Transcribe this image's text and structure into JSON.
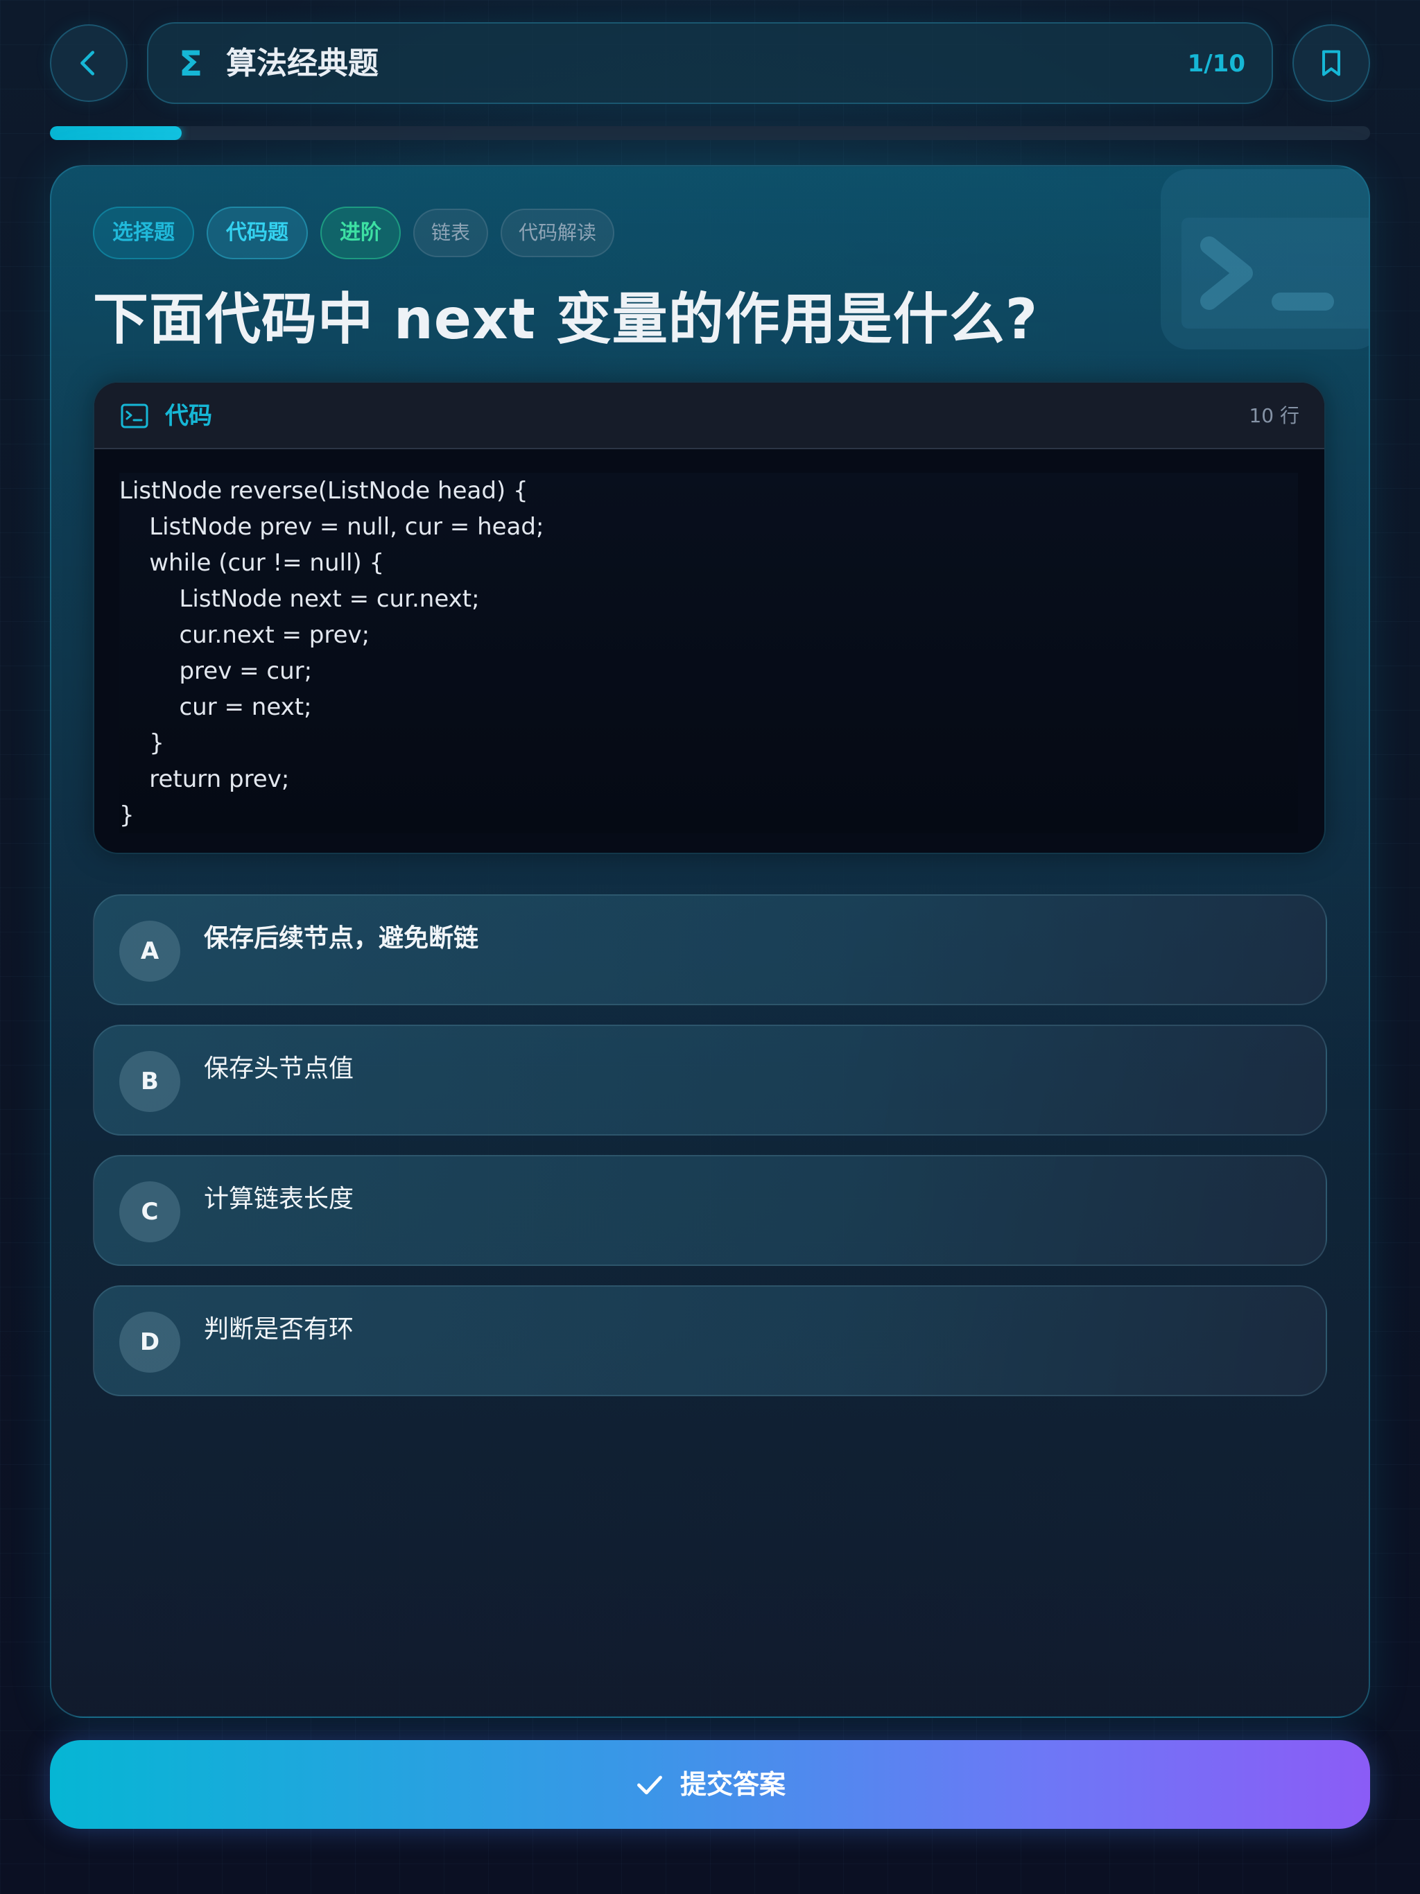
{
  "header": {
    "back_icon": "chevron-left-icon",
    "category_icon": "sigma-icon",
    "category_symbol": "Σ",
    "title": "算法经典题",
    "counter": "1/10",
    "bookmark_icon": "bookmark-icon"
  },
  "progress": {
    "current": 1,
    "total": 10,
    "fraction": 0.1
  },
  "tags": [
    {
      "label": "选择题",
      "kind": "type"
    },
    {
      "label": "代码题",
      "kind": "type2"
    },
    {
      "label": "进阶",
      "kind": "level"
    },
    {
      "label": "链表",
      "kind": "topic"
    },
    {
      "label": "代码解读",
      "kind": "topic"
    }
  ],
  "question": "下面代码中 next 变量的作用是什么?",
  "code": {
    "label": "代码",
    "icon": "terminal-icon",
    "line_count": "10 行",
    "lines": [
      "ListNode reverse(ListNode head) {",
      "    ListNode prev = null, cur = head;",
      "    while (cur != null) {",
      "        ListNode next = cur.next;",
      "        cur.next = prev;",
      "        prev = cur;",
      "        cur = next;",
      "    }",
      "    return prev;",
      "}"
    ]
  },
  "options": [
    {
      "key": "A",
      "text": "保存后续节点，避免断链"
    },
    {
      "key": "B",
      "text": "保存头节点值"
    },
    {
      "key": "C",
      "text": "计算链表长度"
    },
    {
      "key": "D",
      "text": "判断是否有环"
    }
  ],
  "submit": {
    "icon": "check-icon",
    "label": "提交答案"
  },
  "colors": {
    "accent": "#06b6d4",
    "accent_end": "#8b5cf6",
    "level": "#3de0a3"
  }
}
